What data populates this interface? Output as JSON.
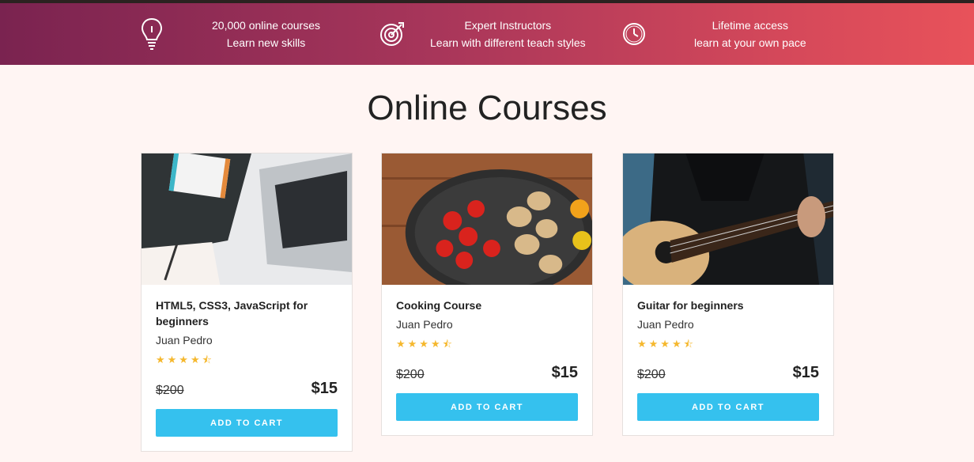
{
  "features": [
    {
      "icon": "lightbulb-icon",
      "line1": "20,000 online courses",
      "line2": "Learn new skills"
    },
    {
      "icon": "target-icon",
      "line1": "Expert Instructors",
      "line2": "Learn with different teach styles"
    },
    {
      "icon": "clock-icon",
      "line1": "Lifetime access",
      "line2": "learn at your own pace"
    }
  ],
  "section_title": "Online Courses",
  "courses": [
    {
      "image": "laptop-notebook-image",
      "title": "HTML5, CSS3, JavaScript for beginners",
      "author": "Juan Pedro",
      "rating": 4.5,
      "stars": "★★★★⯪",
      "old_price": "$200",
      "price": "$15",
      "button": "ADD TO CART"
    },
    {
      "image": "cooking-pan-image",
      "title": "Cooking Course",
      "author": "Juan Pedro",
      "rating": 4.5,
      "stars": "★★★★⯪",
      "old_price": "$200",
      "price": "$15",
      "button": "ADD TO CART"
    },
    {
      "image": "guitar-player-image",
      "title": "Guitar for beginners",
      "author": "Juan Pedro",
      "rating": 4.5,
      "stars": "★★★★⯪",
      "old_price": "$200",
      "price": "$15",
      "button": "ADD TO CART"
    }
  ],
  "colors": {
    "accent_button": "#35c1ee",
    "star": "#f5b82e",
    "banner_start": "#7a2350",
    "banner_end": "#e8525a"
  }
}
